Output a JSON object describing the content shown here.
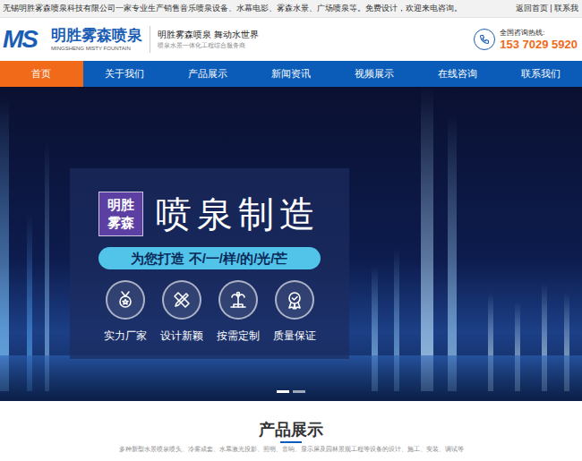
{
  "top_bar": {
    "intro": "无锡明胜雾森喷泉科技有限公司一家专业生产销售音乐喷泉设备、水幕电影、雾森水景、广场喷泉等。免费设计，欢迎来电咨询。",
    "links": "返回首页 | 联系我"
  },
  "header": {
    "logo_mark": "MS",
    "brand": "明胜雾森喷泉",
    "brand_en": "MINGSHENG MISTY FOUNTAIN",
    "slogan": "明胜雾森喷泉 舞动水世界",
    "tagline": "喷泉水景一体化工程综合服务商",
    "hotline_label": "全国咨询热线:",
    "hotline": "153 7029 5920"
  },
  "nav": [
    {
      "label": "首页",
      "selected": true
    },
    {
      "label": "关于我们",
      "selected": false
    },
    {
      "label": "产品展示",
      "selected": false
    },
    {
      "label": "新闻资讯",
      "selected": false
    },
    {
      "label": "视频展示",
      "selected": false
    },
    {
      "label": "在线咨询",
      "selected": false
    },
    {
      "label": "联系我们",
      "selected": false
    }
  ],
  "banner": {
    "badge": [
      "明胜",
      "雾森"
    ],
    "title": "喷泉制造",
    "ribbon": "为您打造 不/一/样/的/光/芒",
    "features": [
      {
        "label": "实力厂家",
        "kind": "medal"
      },
      {
        "label": "设计新颖",
        "kind": "design"
      },
      {
        "label": "按需定制",
        "kind": "fountain"
      },
      {
        "label": "质量保证",
        "kind": "quality"
      }
    ],
    "slides": [
      {
        "selected": true
      },
      {
        "selected": false
      }
    ]
  },
  "section": {
    "title": "产品展示",
    "subtitle": "多种新型水景喷泉喷头、冷雾成套、水幕激光投影、照明、音响、显示屏及园林景观工程等设备的设计、施工、安装、调试等"
  }
}
